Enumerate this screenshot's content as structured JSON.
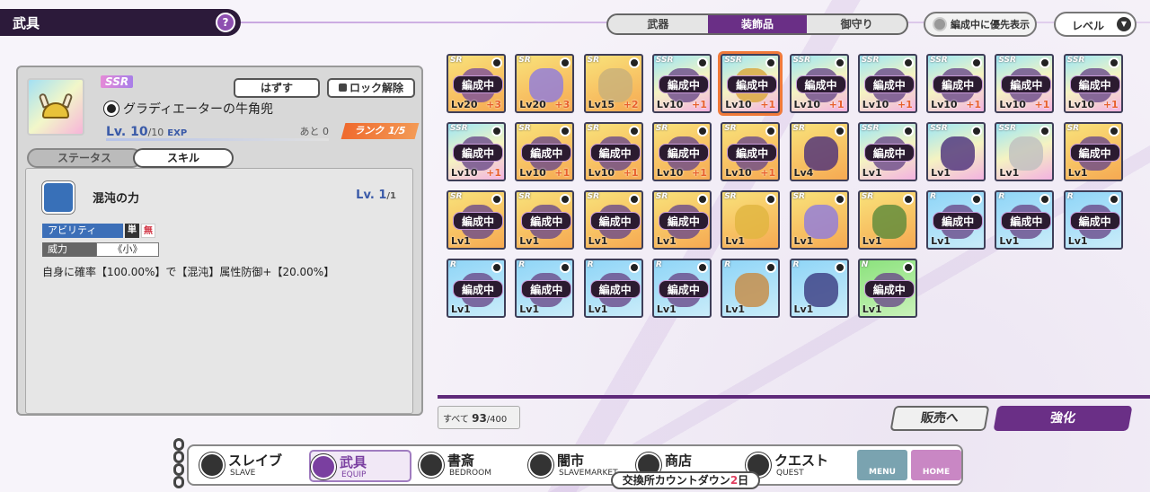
{
  "header": {
    "title": "武具",
    "help_icon": "?"
  },
  "tabs": [
    {
      "label": "武器",
      "active": false
    },
    {
      "label": "装飾品",
      "active": true
    },
    {
      "label": "御守り",
      "active": false
    }
  ],
  "priority_toggle": "編成中に優先表示",
  "sort": {
    "label": "レベル"
  },
  "detail": {
    "rarity": "SSR",
    "unequip_label": "はずす",
    "unlock_label": "ロック解除",
    "name": "グラディエーターの牛角兜",
    "level": "Lv. 10",
    "level_max": "/10",
    "exp_label": "EXP",
    "remaining": "あと 0",
    "rank": "ランク 1/5",
    "subtabs": {
      "status": "ステータス",
      "skill": "スキル"
    },
    "skill": {
      "name": "混沌の力",
      "level": "Lv. 1",
      "level_max": "/1",
      "ability": "アビリティ",
      "tag1": "単",
      "tag2": "無",
      "power_label": "威力",
      "power_value": "《小》",
      "description": "自身に確率【100.00%】で【混沌】属性防御+【20.00%】"
    }
  },
  "grid": {
    "equipped_label": "編成中",
    "items": [
      {
        "rarity": "SR",
        "level": "Lv20",
        "plus": "+3",
        "equipped": true,
        "art": "#7a4f9a"
      },
      {
        "rarity": "SR",
        "level": "Lv20",
        "plus": "+3",
        "equipped": false,
        "art": "#8d7ae0"
      },
      {
        "rarity": "SR",
        "level": "Lv15",
        "plus": "+2",
        "equipped": false,
        "art": "#c8b07a"
      },
      {
        "rarity": "SSR",
        "level": "Lv10",
        "plus": "+1",
        "equipped": true,
        "art": "#6a4a8a"
      },
      {
        "rarity": "SSR",
        "level": "Lv10",
        "plus": "+1",
        "equipped": true,
        "art": "#d9a53a",
        "selected": true
      },
      {
        "rarity": "SSR",
        "level": "Lv10",
        "plus": "+1",
        "equipped": true,
        "art": "#6a4a8a"
      },
      {
        "rarity": "SSR",
        "level": "Lv10",
        "plus": "+1",
        "equipped": true,
        "art": "#6a4a8a"
      },
      {
        "rarity": "SSR",
        "level": "Lv10",
        "plus": "+1",
        "equipped": true,
        "art": "#6a4a8a"
      },
      {
        "rarity": "SSR",
        "level": "Lv10",
        "plus": "+1",
        "equipped": true,
        "art": "#6a4a8a"
      },
      {
        "rarity": "SSR",
        "level": "Lv10",
        "plus": "+1",
        "equipped": true,
        "art": "#6a4a8a"
      },
      {
        "rarity": "SSR",
        "level": "Lv10",
        "plus": "+1",
        "equipped": true,
        "art": "#6a4a8a"
      },
      {
        "rarity": "SR",
        "level": "Lv10",
        "plus": "+1",
        "equipped": true,
        "art": "#6a4a8a"
      },
      {
        "rarity": "SR",
        "level": "Lv10",
        "plus": "+1",
        "equipped": true,
        "art": "#6a4a8a"
      },
      {
        "rarity": "SR",
        "level": "Lv10",
        "plus": "+1",
        "equipped": true,
        "art": "#6a4a8a"
      },
      {
        "rarity": "SR",
        "level": "Lv10",
        "plus": "+1",
        "equipped": true,
        "art": "#6a4a8a"
      },
      {
        "rarity": "SR",
        "level": "Lv4",
        "plus": "",
        "equipped": false,
        "art": "#4a2e7a"
      },
      {
        "rarity": "SSR",
        "level": "Lv1",
        "plus": "",
        "equipped": true,
        "art": "#6a4a8a"
      },
      {
        "rarity": "SSR",
        "level": "Lv1",
        "plus": "",
        "equipped": false,
        "art": "#4a2e7a"
      },
      {
        "rarity": "SSR",
        "level": "Lv1",
        "plus": "",
        "equipped": false,
        "art": "#bfbfbf"
      },
      {
        "rarity": "SR",
        "level": "Lv1",
        "plus": "",
        "equipped": true,
        "art": "#6a4a8a"
      },
      {
        "rarity": "SR",
        "level": "Lv1",
        "plus": "",
        "equipped": true,
        "art": "#6a4a8a"
      },
      {
        "rarity": "SR",
        "level": "Lv1",
        "plus": "",
        "equipped": true,
        "art": "#6a4a8a"
      },
      {
        "rarity": "SR",
        "level": "Lv1",
        "plus": "",
        "equipped": true,
        "art": "#6a4a8a"
      },
      {
        "rarity": "SR",
        "level": "Lv1",
        "plus": "",
        "equipped": true,
        "art": "#6a4a8a"
      },
      {
        "rarity": "SR",
        "level": "Lv1",
        "plus": "",
        "equipped": false,
        "art": "#e0b540"
      },
      {
        "rarity": "SR",
        "level": "Lv1",
        "plus": "",
        "equipped": false,
        "art": "#8d7ae0"
      },
      {
        "rarity": "SR",
        "level": "Lv1",
        "plus": "",
        "equipped": false,
        "art": "#5a8a3a"
      },
      {
        "rarity": "R",
        "level": "Lv1",
        "plus": "",
        "equipped": true,
        "art": "#6a4a8a"
      },
      {
        "rarity": "R",
        "level": "Lv1",
        "plus": "",
        "equipped": true,
        "art": "#6a4a8a"
      },
      {
        "rarity": "R",
        "level": "Lv1",
        "plus": "",
        "equipped": true,
        "art": "#6a4a8a"
      },
      {
        "rarity": "R",
        "level": "Lv1",
        "plus": "",
        "equipped": true,
        "art": "#6a4a8a"
      },
      {
        "rarity": "R",
        "level": "Lv1",
        "plus": "",
        "equipped": true,
        "art": "#6a4a8a"
      },
      {
        "rarity": "R",
        "level": "Lv1",
        "plus": "",
        "equipped": true,
        "art": "#6a4a8a"
      },
      {
        "rarity": "R",
        "level": "Lv1",
        "plus": "",
        "equipped": true,
        "art": "#6a4a8a"
      },
      {
        "rarity": "R",
        "level": "Lv1",
        "plus": "",
        "equipped": false,
        "art": "#c88a40"
      },
      {
        "rarity": "R",
        "level": "Lv1",
        "plus": "",
        "equipped": false,
        "art": "#3a3a80"
      },
      {
        "rarity": "N",
        "level": "Lv1",
        "plus": "",
        "equipped": true,
        "art": "#6a4a8a"
      }
    ]
  },
  "footer": {
    "count_label": "すべて",
    "count_value": "93",
    "count_max": "/400",
    "sell_label": "販売へ",
    "enhance_label": "強化"
  },
  "nav": [
    {
      "title": "スレイブ",
      "sub": "SLAVE",
      "active": false
    },
    {
      "title": "武具",
      "sub": "EQUIP",
      "active": true
    },
    {
      "title": "書斎",
      "sub": "BEDROOM",
      "active": false
    },
    {
      "title": "闇市",
      "sub": "SLAVEMARKET",
      "active": false
    },
    {
      "title": "商店",
      "sub": "",
      "active": false
    },
    {
      "title": "クエスト",
      "sub": "QUEST",
      "active": false
    }
  ],
  "menu_label": "MENU",
  "home_label": "HOME",
  "countdown": {
    "label": "交換所カウントダウン",
    "days": "2",
    "unit": "日"
  }
}
